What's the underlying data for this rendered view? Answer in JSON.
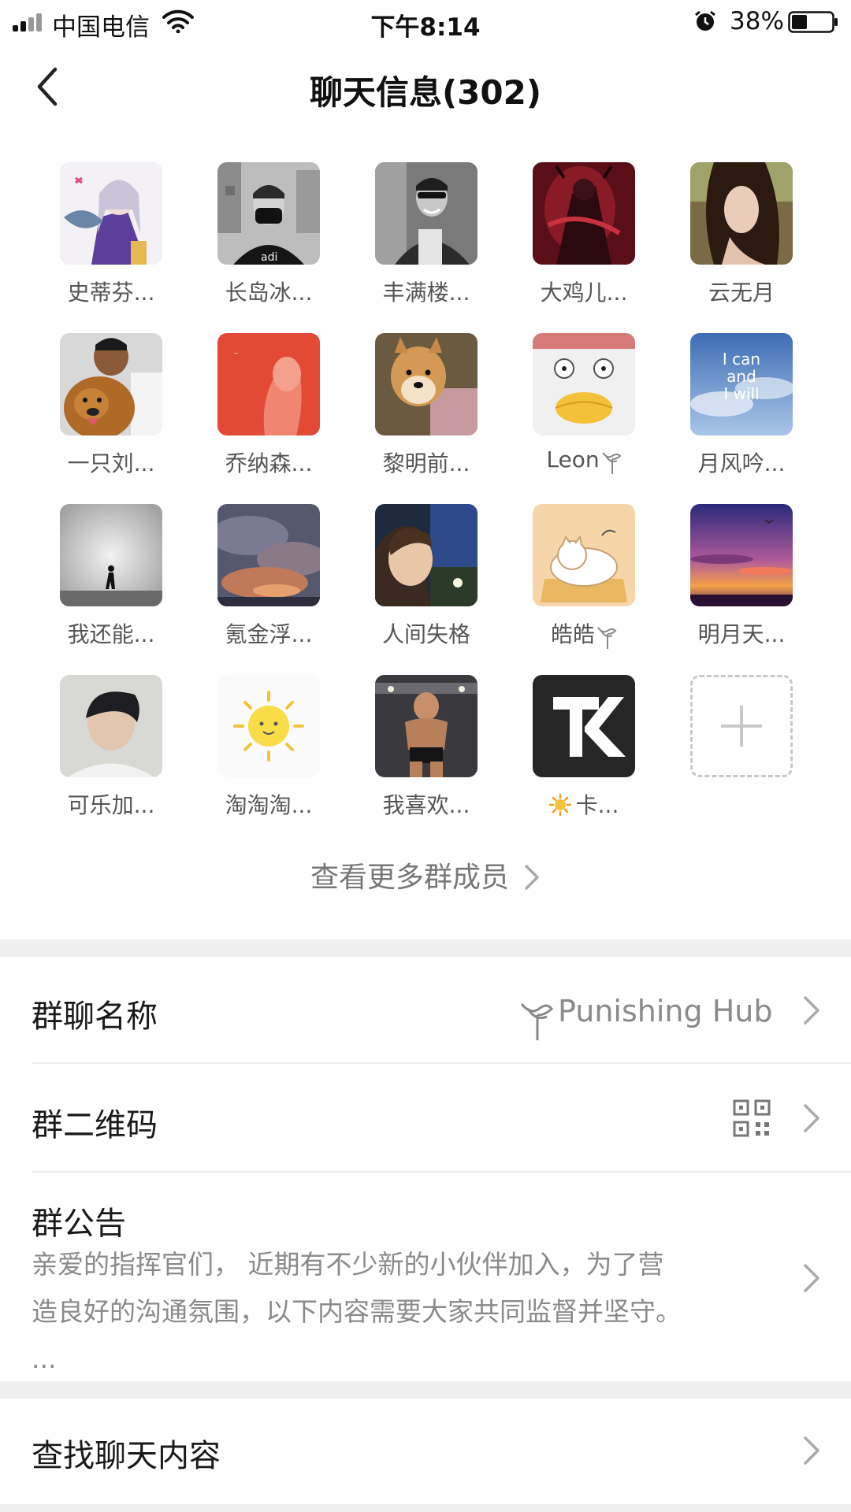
{
  "status_bar": {
    "carrier": "中国电信",
    "time": "下午8:14",
    "battery": "38%"
  },
  "header": {
    "title": "聊天信息(302)"
  },
  "members": [
    {
      "name": "史蒂芬...",
      "avatar": "anime-girl"
    },
    {
      "name": "长岛冰...",
      "avatar": "bw-masked-man"
    },
    {
      "name": "丰满楼...",
      "avatar": "bw-smiling-man"
    },
    {
      "name": "大鸡儿...",
      "avatar": "red-armored-warrior"
    },
    {
      "name": "云无月",
      "avatar": "woman-portrait"
    },
    {
      "name": "一只刘...",
      "avatar": "man-with-dog"
    },
    {
      "name": "乔纳森...",
      "avatar": "red-poster"
    },
    {
      "name": "黎明前...",
      "avatar": "shiba-dog"
    },
    {
      "name": "Leon",
      "avatar": "white-duck-cartoon",
      "badge": "punishing-icon"
    },
    {
      "name": "月风吟...",
      "avatar": "sky-text",
      "avatar_text": "I can and I will"
    },
    {
      "name": "我还能...",
      "avatar": "silhouette-walker"
    },
    {
      "name": "氪金浮...",
      "avatar": "cloudy-sky"
    },
    {
      "name": "人间失格",
      "avatar": "young-man-night"
    },
    {
      "name": "皓皓",
      "avatar": "cat-cartoon",
      "badge": "punishing-icon"
    },
    {
      "name": "明月天...",
      "avatar": "sunset-sky"
    },
    {
      "name": "可乐加...",
      "avatar": "boy-portrait"
    },
    {
      "name": "淘淘淘...",
      "avatar": "sun-cartoon"
    },
    {
      "name": "我喜欢...",
      "avatar": "gym-man"
    },
    {
      "name": "卡...",
      "avatar": "tk-logo",
      "avatar_text": "TK",
      "prefix_icon": "sun-emoji"
    }
  ],
  "view_more": "查看更多群成员",
  "rows": {
    "group_name": {
      "label": "群聊名称",
      "value": "Punishing Hub"
    },
    "qr_code": {
      "label": "群二维码"
    },
    "notice": {
      "label": "群公告",
      "line1": "亲爱的指挥官们， 近期有不少新的小伙伴加入，为了营",
      "line2": "造良好的沟通氛围，以下内容需要大家共同监督并坚守。",
      "line3": "..."
    },
    "search": {
      "label": "查找聊天内容"
    }
  },
  "colors": {
    "background": "#ffffff",
    "separator": "#efefef",
    "secondary_text": "#8a8a8a"
  }
}
